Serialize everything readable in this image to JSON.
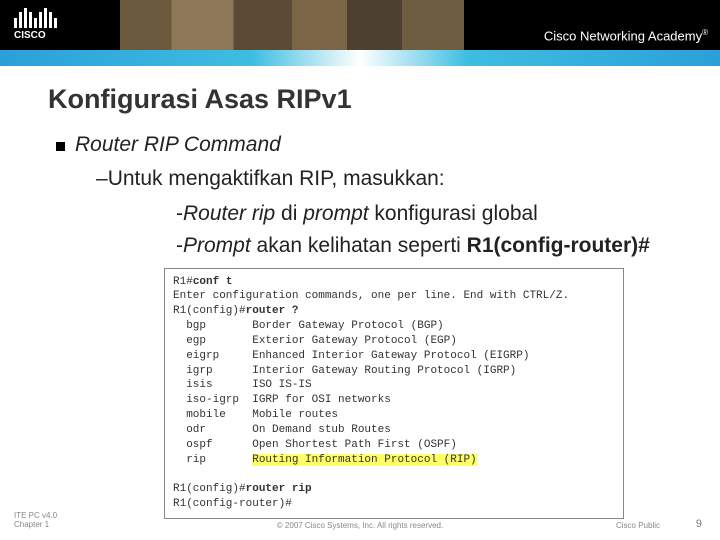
{
  "header": {
    "logo_text": "CISCO",
    "academy": "Cisco Networking Academy"
  },
  "title": "Konfigurasi Asas RIPv1",
  "bullet1": "Router RIP Command",
  "sub1_prefix": "–",
  "sub1_text": "Untuk mengaktifkan RIP, masukkan:",
  "sub2a_dash": "-",
  "sub2a_em": "Router rip",
  "sub2a_rest": " di ",
  "sub2a_em2": "prompt",
  "sub2a_rest2": " konfigurasi global",
  "sub2b_dash": "-",
  "sub2b_em": "Prompt",
  "sub2b_rest": " akan kelihatan seperti ",
  "sub2b_strong": "R1(config-router)#",
  "terminal": {
    "l1a": "R1#",
    "l1b": "conf t",
    "l2": "Enter configuration commands, one per line. End with CTRL/Z.",
    "l3a": "R1(config)#",
    "l3b": "router ?",
    "l4": "  bgp       Border Gateway Protocol (BGP)",
    "l5": "  egp       Exterior Gateway Protocol (EGP)",
    "l6": "  eigrp     Enhanced Interior Gateway Protocol (EIGRP)",
    "l7": "  igrp      Interior Gateway Routing Protocol (IGRP)",
    "l8": "  isis      ISO IS-IS",
    "l9": "  iso-igrp  IGRP for OSI networks",
    "l10": "  mobile    Mobile routes",
    "l11": "  odr       On Demand stub Routes",
    "l12": "  ospf      Open Shortest Path First (OSPF)",
    "l13a": "  rip       ",
    "l13b": "Routing Information Protocol (RIP)",
    "l14": "",
    "l15a": "R1(config)#",
    "l15b": "router rip",
    "l16": "R1(config-router)#"
  },
  "footer": {
    "left1": "ITE PC v4.0",
    "left2": "Chapter 1",
    "center": "© 2007 Cisco Systems, Inc. All rights reserved.",
    "right": "Cisco Public",
    "page": "9"
  }
}
